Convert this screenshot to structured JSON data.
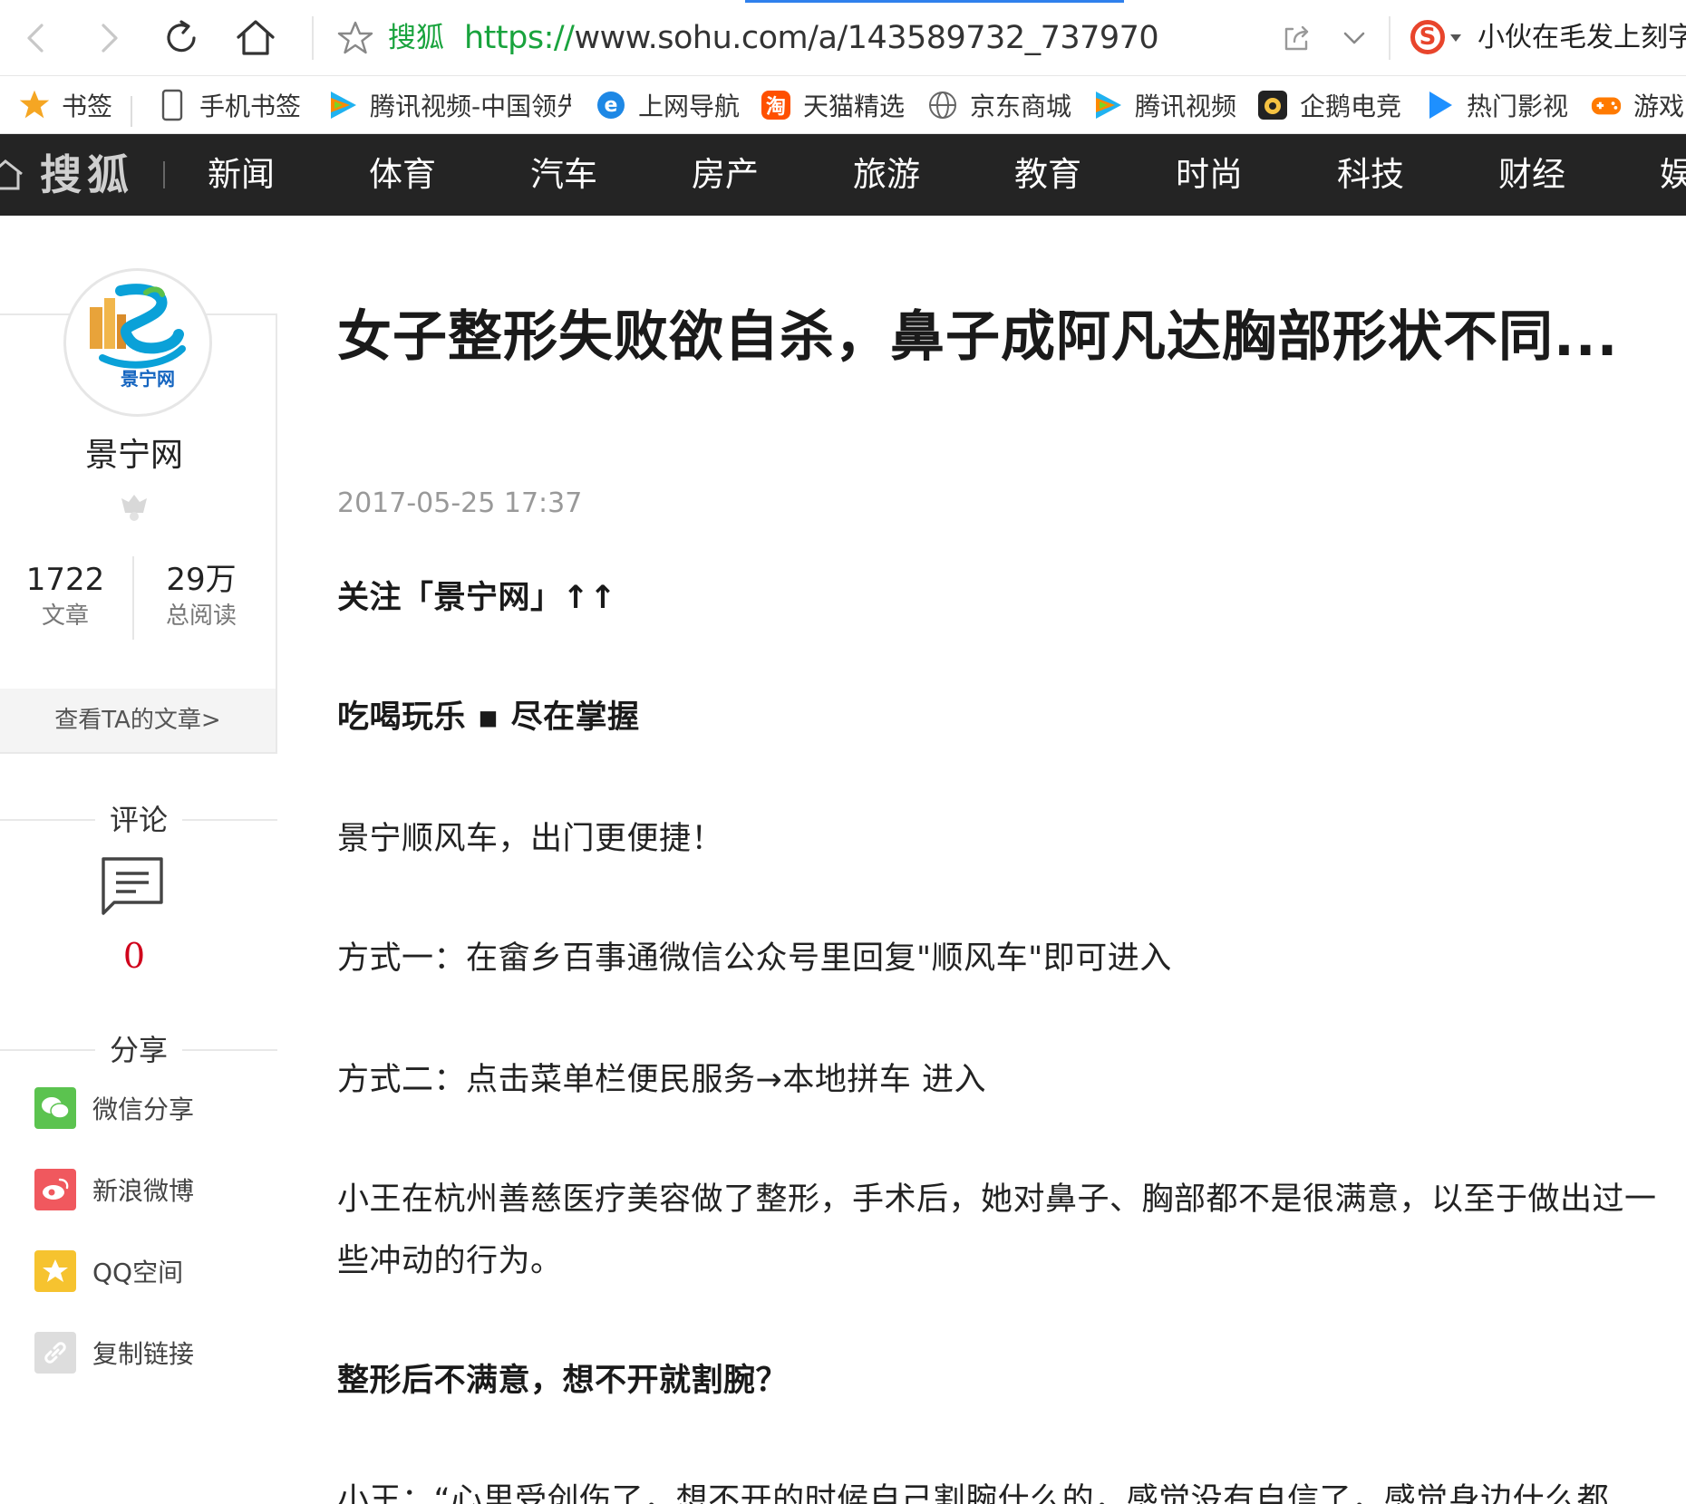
{
  "browser": {
    "site_label": "搜狐",
    "url_protocol": "https://",
    "url_rest": "www.sohu.com/a/143589732_737970",
    "hot_search": "小伙在毛发上刻字"
  },
  "bookmarks": [
    {
      "label": "书签",
      "icon": "star-icon"
    },
    {
      "label": "手机书签",
      "icon": "phone-icon"
    },
    {
      "label": "腾讯视频-中国领先",
      "icon": "tencent-video-icon"
    },
    {
      "label": "上网导航",
      "icon": "ie-icon"
    },
    {
      "label": "天猫精选",
      "icon": "taobao-icon"
    },
    {
      "label": "京东商城",
      "icon": "globe-icon"
    },
    {
      "label": "腾讯视频",
      "icon": "tencent-video-icon"
    },
    {
      "label": "企鹅电竞",
      "icon": "penguin-esports-icon"
    },
    {
      "label": "热门影视",
      "icon": "play-icon"
    },
    {
      "label": "游戏中",
      "icon": "gamepad-icon"
    }
  ],
  "nav": {
    "logo": "搜狐",
    "items": [
      "新闻",
      "体育",
      "汽车",
      "房产",
      "旅游",
      "教育",
      "时尚",
      "科技",
      "财经",
      "娱"
    ]
  },
  "author": {
    "name": "景宁网",
    "avatar_text": "景宁网",
    "articles_count": "1722",
    "articles_label": "文章",
    "reads_count": "29万",
    "reads_label": "总阅读",
    "view_link": "查看TA的文章>"
  },
  "comments": {
    "title": "评论",
    "count": "0"
  },
  "share": {
    "title": "分享",
    "items": [
      {
        "label": "微信分享",
        "icon": "wechat-icon",
        "color": "#5bc34f"
      },
      {
        "label": "新浪微博",
        "icon": "weibo-icon",
        "color": "#f0585e"
      },
      {
        "label": "QQ空间",
        "icon": "qzone-icon",
        "color": "#f6c32f"
      },
      {
        "label": "复制链接",
        "icon": "link-icon",
        "color": "#dddddd"
      }
    ]
  },
  "article": {
    "title": "女子整形失败欲自杀，鼻子成阿凡达胸部形状不同...",
    "date": "2017-05-25 17:37",
    "paragraphs": [
      "关注「景宁网」↑↑",
      "吃喝玩乐 ▪ 尽在掌握",
      "景宁顺风车，出门更便捷！",
      "方式一：在畲乡百事通微信公众号里回复\"顺风车\"即可进入",
      "方式二：点击菜单栏便民服务→本地拼车 进入",
      "小王在杭州善慈医疗美容做了整形，手术后，她对鼻子、胸部都不是很满意，以至于做出过一些冲动的行为。",
      "整形后不满意，想不开就割腕？",
      "小王：“心里受创伤了，想不开的时候自己割腕什么的，感觉没有自信了，感觉身边什么都"
    ]
  }
}
